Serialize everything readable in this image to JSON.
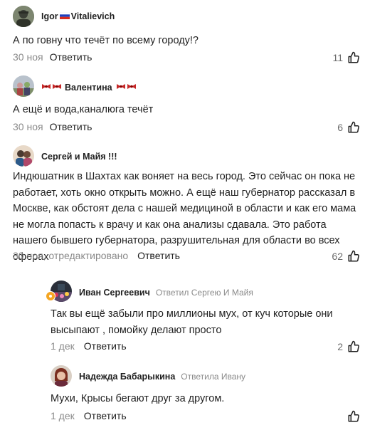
{
  "comments": [
    {
      "author": "Igor",
      "author_suffix": "Vitalievich",
      "text": "А по говну что течёт по всему городу!?",
      "date": "30 ноя",
      "reply_label": "Ответить",
      "likes": "11"
    },
    {
      "author": "Валентина",
      "text": "А ещё и вода,каналюга течёт",
      "date": "30 ноя",
      "reply_label": "Ответить",
      "likes": "6"
    },
    {
      "author": "Сергей и Майя !!!",
      "text": "Индюшатник в Шахтах как воняет на весь город. Это сейчас он пока не работает, хоть окно открыть можно. А ещё наш губернатор рассказал в Москве, как обстоят дела с нашей медициной в области и как его мама не могла попасть к врачу и как она анализы сдавала. Это работа нашего бывшего губернатора, разрушительная для области во всех сферах",
      "date": "30 ноя, отредактировано",
      "reply_label": "Ответить",
      "likes": "62"
    },
    {
      "author": "Иван Сергеевич",
      "reply_to": "Ответил Сергею И Майя",
      "text": "Так вы ещё забыли про миллионы мух, от куч которые они высыпают , помойку делают просто",
      "date": "1 дек",
      "reply_label": "Ответить",
      "likes": "2"
    },
    {
      "author": "Надежда Бабарыкина",
      "reply_to": "Ответила Ивану",
      "text": "Мухи, Крысы бегают друг за другом.",
      "date": "1 дек",
      "reply_label": "Ответить",
      "likes": ""
    }
  ],
  "colors": {
    "text": "#1f1f1f",
    "muted": "#8a8a8a",
    "badge": "#f5a623"
  }
}
